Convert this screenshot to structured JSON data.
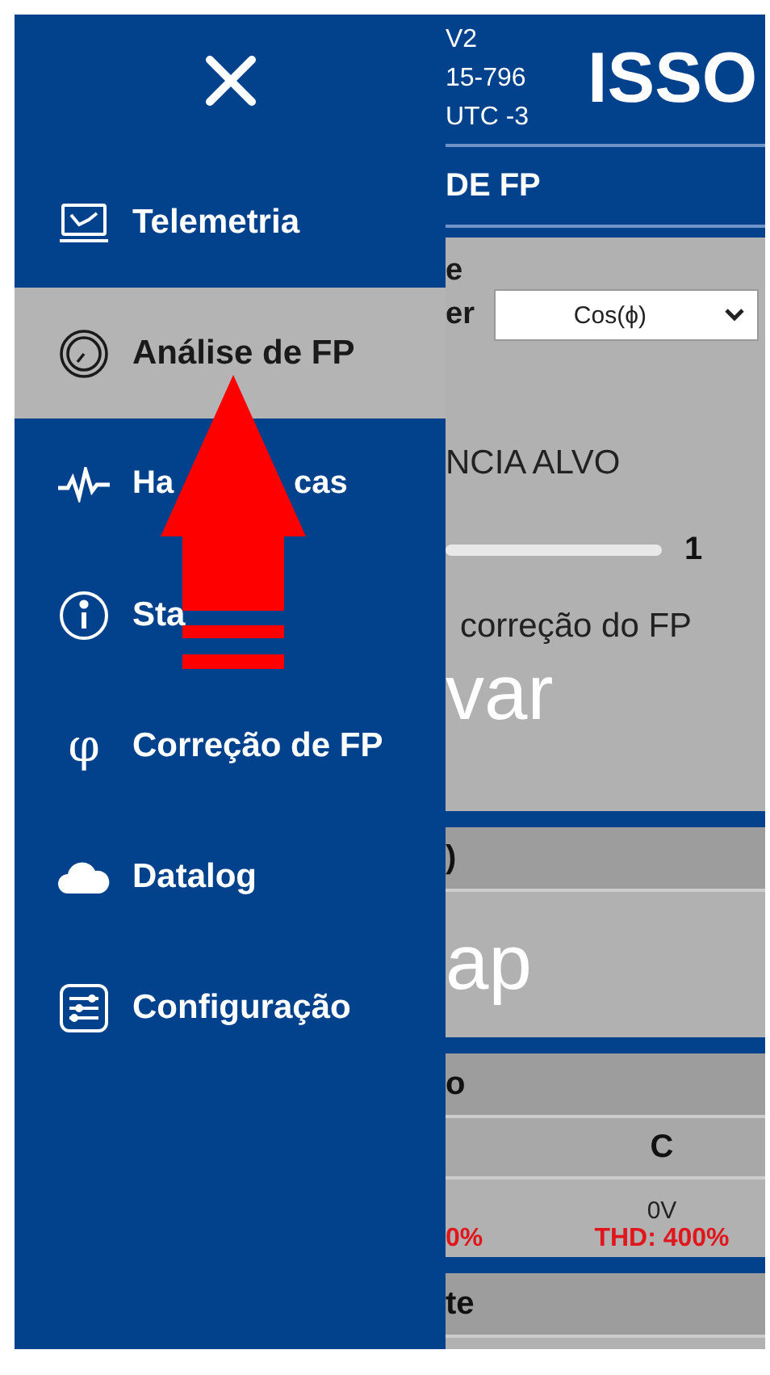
{
  "drawer": {
    "menu": [
      {
        "label_parts": [
          "Telemetria"
        ],
        "kind": "monitor",
        "selected": false
      },
      {
        "label_parts": [
          "Análise de FP"
        ],
        "kind": "gauge",
        "selected": true
      },
      {
        "label_parts": [
          "Ha",
          "cas"
        ],
        "kind": "pulse",
        "selected": false
      },
      {
        "label_parts": [
          "Sta"
        ],
        "kind": "info",
        "selected": false
      },
      {
        "label_parts": [
          "Correção de FP"
        ],
        "kind": "glyph",
        "glyph": "φ",
        "selected": false
      },
      {
        "label_parts": [
          "Datalog"
        ],
        "kind": "cloud",
        "selected": false
      },
      {
        "label_parts": [
          "Configuração"
        ],
        "kind": "sliders",
        "selected": false
      }
    ]
  },
  "header": {
    "lines": [
      "V2",
      "15-796",
      "UTC -3"
    ],
    "brand": "ISSO",
    "title": "DE FP"
  },
  "panel": {
    "label_1": "e",
    "label_2": "er",
    "select": "Cos(ϕ)",
    "target_label": "NCIA ALVO",
    "slider_value": "1",
    "correction_label": "correção do FP",
    "button": "var"
  },
  "section_2": {
    "header": ")",
    "button": "ap"
  },
  "section_3": {
    "header": "o",
    "columns": [
      "",
      "C"
    ],
    "rows": [
      {
        "cells": [
          {
            "thd": "0%"
          },
          {
            "value": "0V",
            "thd": "THD: 400%"
          }
        ]
      }
    ]
  },
  "section_4": {
    "header": "te"
  }
}
